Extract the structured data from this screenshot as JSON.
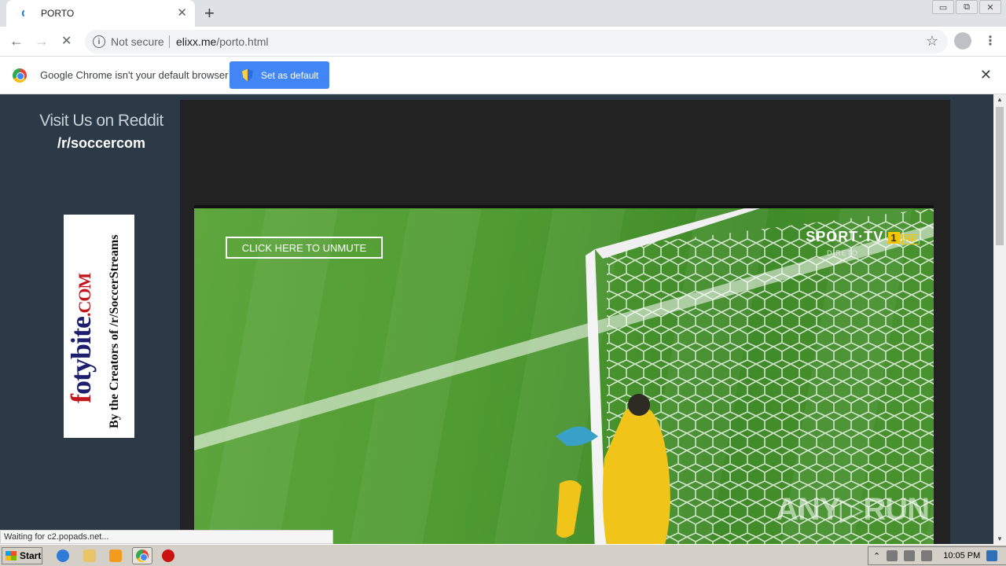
{
  "tab": {
    "title": "PORTO",
    "close": "✕",
    "new": "+"
  },
  "window_buttons": [
    "▭",
    "⧉",
    "✕"
  ],
  "toolbar": {
    "back": "←",
    "forward": "→",
    "reload": "✕",
    "not_secure": "Not secure",
    "url_host": "elixx.me",
    "url_path": "/porto.html",
    "info_icon": "i",
    "star": "☆",
    "menu": "⋮"
  },
  "infobar": {
    "message": "Google Chrome isn't your default browser",
    "button": "Set as default",
    "close": "✕"
  },
  "page": {
    "reddit_line1": "Visit Us on Reddit",
    "reddit_line2": "/r/soccercom",
    "banner_brand_a": "f",
    "banner_brand_b": "otybite",
    "banner_brand_c": ".COM",
    "banner_tagline": "By the Creators of /r/SoccerStreams",
    "unmute": "CLICK HERE TO UNMUTE",
    "tv_logo": "SPORT·TV",
    "tv_channel": "1",
    "tv_hd": "HD",
    "tv_sub": "DIRETO",
    "watermark": "ANY▷RUN"
  },
  "status_text": "Waiting for c2.popads.net...",
  "taskbar": {
    "start": "Start",
    "clock": "10:05 PM",
    "tray_arrow": "⌃"
  },
  "scroll": {
    "up": "▲",
    "down": "▼"
  }
}
